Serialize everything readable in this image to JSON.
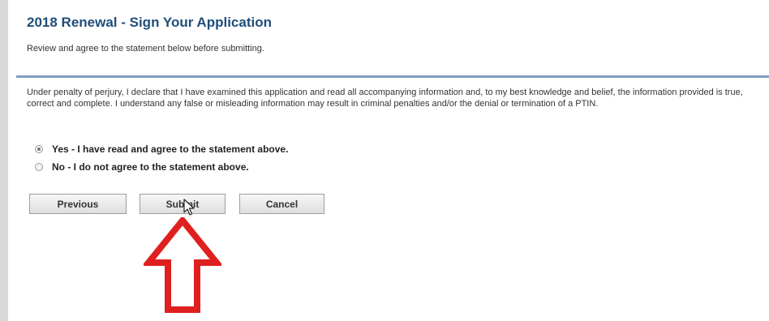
{
  "header": {
    "title": "2018 Renewal - Sign Your Application",
    "subtitle": "Review and agree to the statement below before submitting."
  },
  "statement": {
    "text": "Under penalty of perjury, I declare that I have examined this application and read all accompanying information and, to my best knowledge and belief, the information provided is true, correct and complete. I understand any false or misleading information may result in criminal penalties and/or the denial or termination of a PTIN."
  },
  "agreement": {
    "options": [
      {
        "label": "Yes - I have read and agree to the statement above.",
        "selected": true
      },
      {
        "label": "No - I do not agree to the statement above.",
        "selected": false
      }
    ]
  },
  "buttons": {
    "previous": "Previous",
    "submit": "Submit",
    "cancel": "Cancel"
  },
  "colors": {
    "title": "#1f4e79",
    "rule": "#7f9fc4",
    "annotation_arrow": "#e02020"
  },
  "icons": {
    "pointer": "mouse-pointer-icon",
    "annotation": "up-arrow-icon"
  }
}
